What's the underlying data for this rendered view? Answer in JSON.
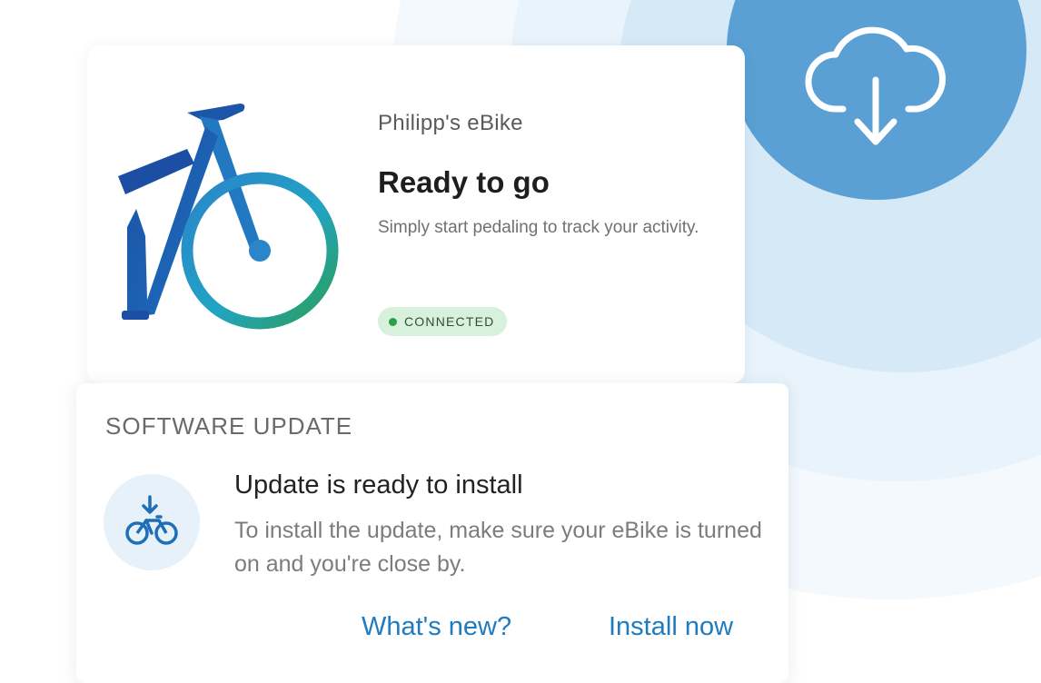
{
  "bike_card": {
    "bike_name": "Philipp's eBike",
    "status_title": "Ready to go",
    "status_description": "Simply start pedaling to track your activity.",
    "connection_badge": "CONNECTED",
    "connection_color": "#2f9e48"
  },
  "update_card": {
    "section_title": "SOFTWARE UPDATE",
    "heading": "Update is ready to install",
    "body": "To install the update, make sure your eBike is turned on and you're close by.",
    "whats_new_label": "What's new?",
    "install_now_label": "Install now",
    "link_color": "#1f7bc0"
  },
  "icons": {
    "cloud": "cloud-download-icon",
    "bike_update": "bike-download-icon",
    "bike_illustration": "ebike-illustration"
  },
  "colors": {
    "accent_circle": "#5aa0d4",
    "badge_background": "#d7f1dc"
  }
}
